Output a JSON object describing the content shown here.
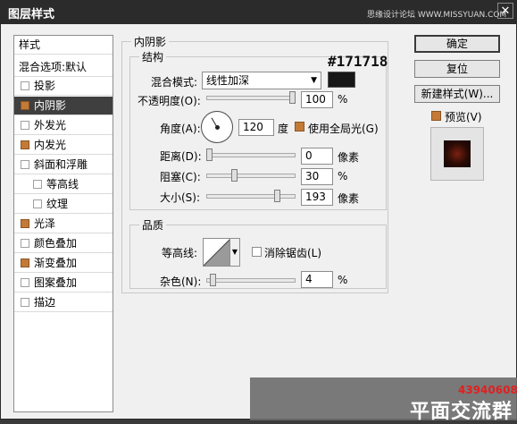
{
  "window": {
    "title": "图层样式",
    "watermark_top": "思缘设计论坛 WWW.MISSYUAN.COM",
    "close_glyph": "✕"
  },
  "styles_list": {
    "header": "样式",
    "blend_options": "混合选项:默认",
    "items": [
      {
        "label": "投影",
        "checked": false,
        "selected": false,
        "sub": false
      },
      {
        "label": "内阴影",
        "checked": true,
        "selected": true,
        "sub": false
      },
      {
        "label": "外发光",
        "checked": false,
        "selected": false,
        "sub": false
      },
      {
        "label": "内发光",
        "checked": true,
        "selected": false,
        "sub": false
      },
      {
        "label": "斜面和浮雕",
        "checked": false,
        "selected": false,
        "sub": false
      },
      {
        "label": "等高线",
        "checked": false,
        "selected": false,
        "sub": true
      },
      {
        "label": "纹理",
        "checked": false,
        "selected": false,
        "sub": true
      },
      {
        "label": "光泽",
        "checked": true,
        "selected": false,
        "sub": false
      },
      {
        "label": "颜色叠加",
        "checked": false,
        "selected": false,
        "sub": false
      },
      {
        "label": "渐变叠加",
        "checked": true,
        "selected": false,
        "sub": false
      },
      {
        "label": "图案叠加",
        "checked": false,
        "selected": false,
        "sub": false
      },
      {
        "label": "描边",
        "checked": false,
        "selected": false,
        "sub": false
      }
    ]
  },
  "inner_shadow": {
    "group_title": "内阴影",
    "structure": {
      "group_title": "结构",
      "blend_mode_label": "混合模式:",
      "blend_mode_value": "线性加深",
      "color_hex_label": "#171718",
      "color": "#171718",
      "opacity_label": "不透明度(O):",
      "opacity_value": "100",
      "opacity_unit": "%",
      "opacity_fraction": 1.0,
      "angle_label": "角度(A):",
      "angle_value": "120",
      "angle_unit": "度",
      "global_light_label": "使用全局光(G)",
      "global_light_checked": true,
      "distance_label": "距离(D):",
      "distance_value": "0",
      "distance_unit": "像素",
      "choke_label": "阻塞(C):",
      "choke_value": "30",
      "choke_unit": "%",
      "size_label": "大小(S):",
      "size_value": "193",
      "size_unit": "像素"
    },
    "quality": {
      "group_title": "品质",
      "contour_label": "等高线:",
      "anti_alias_label": "消除锯齿(L)",
      "anti_alias_checked": false,
      "noise_label": "杂色(N):",
      "noise_value": "4",
      "noise_unit": "%"
    }
  },
  "buttons": {
    "ok": "确定",
    "reset": "复位",
    "new_style": "新建样式(W)...",
    "preview_label": "预览(V)",
    "preview_checked": true
  },
  "overlay": {
    "qq_number": "43940608",
    "group_text": "平面交流群"
  },
  "colors": {
    "accent_checkbox": "#c47a37",
    "selected_row": "#3f3f3f"
  }
}
